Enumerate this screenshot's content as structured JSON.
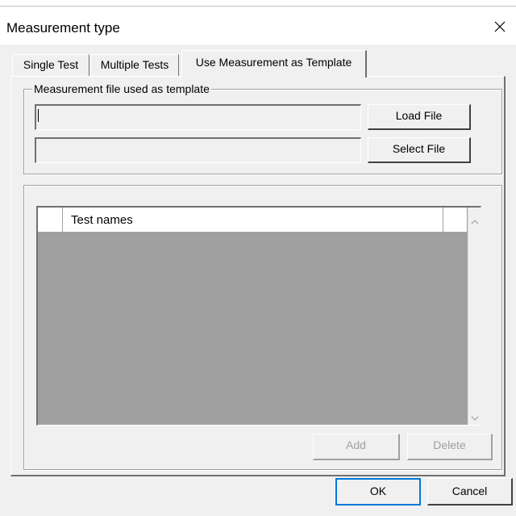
{
  "dialog": {
    "title": "Measurement type",
    "close_icon": "close-icon"
  },
  "tabs": [
    {
      "label": "Single Test",
      "active": false
    },
    {
      "label": "Multiple Tests",
      "active": false
    },
    {
      "label": "Use Measurement as Template",
      "active": true
    }
  ],
  "template_group": {
    "legend": "Measurement file used as template",
    "file_path_value": "",
    "selected_file_value": "",
    "load_button": "Load File",
    "select_button": "Select File"
  },
  "test_list": {
    "column_header": "Test names",
    "rows": [],
    "add_button": "Add",
    "delete_button": "Delete",
    "scroll_up_icon": "chevron-up-icon",
    "scroll_down_icon": "chevron-down-icon"
  },
  "footer": {
    "ok_button": "OK",
    "cancel_button": "Cancel"
  }
}
